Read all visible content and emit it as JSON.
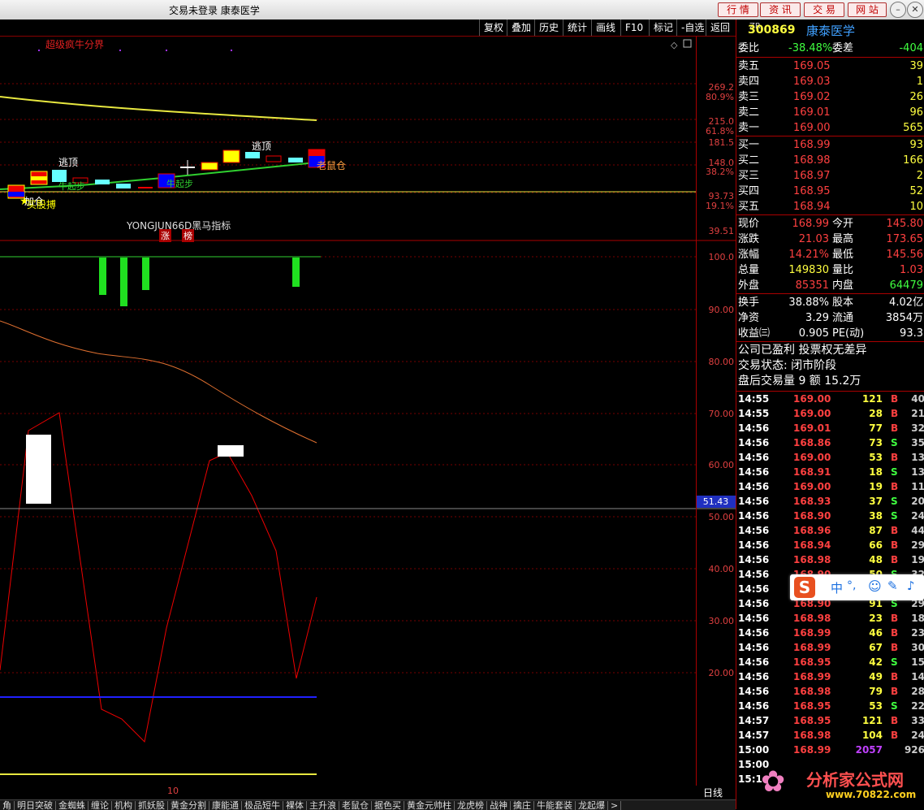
{
  "titlebar": {
    "title": "交易未登录  康泰医学",
    "buttons": [
      "行 情",
      "资 讯",
      "交 易",
      "网 站"
    ]
  },
  "menubar": {
    "items": [
      "复权",
      "叠加",
      "历史",
      "统计",
      "画线",
      "F10",
      "标记",
      "-自选",
      "返回"
    ]
  },
  "main_chart": {
    "indicator_name": "超级疯牛分界",
    "axis_labels": [
      "269.2",
      "80.9%",
      "215.0",
      "61.8%",
      "181.5",
      "148.0",
      "38.2%",
      "93.73",
      "19.1%",
      "39.51"
    ],
    "annotations": [
      "逃顶",
      "逃顶",
      "老鼠仓",
      "牛起步",
      "牛起步",
      "加仓",
      "买股搏"
    ],
    "sub_indicator": "YONGJUN66D黑马指标",
    "tags": [
      "涨",
      "榜"
    ]
  },
  "osc_chart": {
    "axis_labels": [
      "100.0",
      "90.00",
      "80.00",
      "70.00",
      "60.00",
      "50.00",
      "40.00",
      "30.00",
      "20.00"
    ],
    "current_value": "51.43"
  },
  "date_label": "10",
  "period_label": "日线",
  "bottom_tabs": [
    "角",
    "明日突破",
    "金蜘蛛",
    "缠论",
    "机构",
    "抓妖股",
    "黄金分割",
    "康能通",
    "极品短牛",
    "裸体",
    "主升浪",
    "老鼠仓",
    "据色买",
    "黄金元帅柱",
    "龙虎榜",
    "战神",
    "擒庄",
    "牛能套装",
    "龙起爆",
    ">"
  ],
  "quote": {
    "code": "300869",
    "name": "康泰医学",
    "prefix": "ZR",
    "weibi_label": "委比",
    "weibi": "-38.48%",
    "weicha_label": "委差",
    "weicha": "-404",
    "sells": [
      {
        "label": "卖五",
        "price": "169.05",
        "vol": "39"
      },
      {
        "label": "卖四",
        "price": "169.03",
        "vol": "1"
      },
      {
        "label": "卖三",
        "price": "169.02",
        "vol": "26"
      },
      {
        "label": "卖二",
        "price": "169.01",
        "vol": "96"
      },
      {
        "label": "卖一",
        "price": "169.00",
        "vol": "565"
      }
    ],
    "buys": [
      {
        "label": "买一",
        "price": "168.99",
        "vol": "93"
      },
      {
        "label": "买二",
        "price": "168.98",
        "vol": "166"
      },
      {
        "label": "买三",
        "price": "168.97",
        "vol": "2"
      },
      {
        "label": "买四",
        "price": "168.95",
        "vol": "52"
      },
      {
        "label": "买五",
        "price": "168.94",
        "vol": "10"
      }
    ],
    "stats": [
      {
        "l1": "现价",
        "v1": "168.99",
        "l2": "今开",
        "v2": "145.80",
        "c1": "#ff4040",
        "c2": "#ff4040"
      },
      {
        "l1": "涨跌",
        "v1": "21.03",
        "l2": "最高",
        "v2": "173.65",
        "c1": "#ff4040",
        "c2": "#ff4040"
      },
      {
        "l1": "涨幅",
        "v1": "14.21%",
        "l2": "最低",
        "v2": "145.56",
        "c1": "#ff4040",
        "c2": "#ff4040"
      },
      {
        "l1": "总量",
        "v1": "149830",
        "l2": "量比",
        "v2": "1.03",
        "c1": "#ffff40",
        "c2": "#ff4040"
      },
      {
        "l1": "外盘",
        "v1": "85351",
        "l2": "内盘",
        "v2": "64479",
        "c1": "#ff4040",
        "c2": "#40ff40"
      }
    ],
    "stats2": [
      {
        "l1": "换手",
        "v1": "38.88%",
        "l2": "股本",
        "v2": "4.02亿"
      },
      {
        "l1": "净资",
        "v1": "3.29",
        "l2": "流通",
        "v2": "3854万"
      },
      {
        "l1": "收益㈢",
        "v1": "0.905",
        "l2": "PE(动)",
        "v2": "93.3"
      }
    ],
    "notes": [
      "公司已盈利 投票权无差异",
      "交易状态: 闭市阶段",
      "盘后交易量 9 额 15.2万"
    ],
    "ticks": [
      {
        "t": "14:55",
        "p": "169.00",
        "v": "121",
        "d": "B",
        "n": "40"
      },
      {
        "t": "14:55",
        "p": "169.00",
        "v": "28",
        "d": "B",
        "n": "21"
      },
      {
        "t": "14:56",
        "p": "169.01",
        "v": "77",
        "d": "B",
        "n": "32"
      },
      {
        "t": "14:56",
        "p": "168.86",
        "v": "73",
        "d": "S",
        "n": "35"
      },
      {
        "t": "14:56",
        "p": "169.00",
        "v": "53",
        "d": "B",
        "n": "13"
      },
      {
        "t": "14:56",
        "p": "168.91",
        "v": "18",
        "d": "S",
        "n": "13"
      },
      {
        "t": "14:56",
        "p": "169.00",
        "v": "19",
        "d": "B",
        "n": "11"
      },
      {
        "t": "14:56",
        "p": "168.93",
        "v": "37",
        "d": "S",
        "n": "20"
      },
      {
        "t": "14:56",
        "p": "168.90",
        "v": "38",
        "d": "S",
        "n": "24"
      },
      {
        "t": "14:56",
        "p": "168.96",
        "v": "87",
        "d": "B",
        "n": "44"
      },
      {
        "t": "14:56",
        "p": "168.94",
        "v": "66",
        "d": "B",
        "n": "29"
      },
      {
        "t": "14:56",
        "p": "168.98",
        "v": "48",
        "d": "B",
        "n": "19"
      },
      {
        "t": "14:56",
        "p": "168.90",
        "v": "50",
        "d": "S",
        "n": "32"
      },
      {
        "t": "14:56",
        "p": "",
        "v": "",
        "d": "",
        "n": ""
      },
      {
        "t": "14:56",
        "p": "168.90",
        "v": "91",
        "d": "S",
        "n": "29"
      },
      {
        "t": "14:56",
        "p": "168.98",
        "v": "23",
        "d": "B",
        "n": "18"
      },
      {
        "t": "14:56",
        "p": "168.99",
        "v": "46",
        "d": "B",
        "n": "23"
      },
      {
        "t": "14:56",
        "p": "168.99",
        "v": "67",
        "d": "B",
        "n": "30"
      },
      {
        "t": "14:56",
        "p": "168.95",
        "v": "42",
        "d": "S",
        "n": "15"
      },
      {
        "t": "14:56",
        "p": "168.99",
        "v": "49",
        "d": "B",
        "n": "14"
      },
      {
        "t": "14:56",
        "p": "168.98",
        "v": "79",
        "d": "B",
        "n": "28"
      },
      {
        "t": "14:56",
        "p": "168.95",
        "v": "53",
        "d": "S",
        "n": "22"
      },
      {
        "t": "14:57",
        "p": "168.95",
        "v": "121",
        "d": "B",
        "n": "33"
      },
      {
        "t": "14:57",
        "p": "168.98",
        "v": "104",
        "d": "B",
        "n": "24"
      },
      {
        "t": "15:00",
        "p": "168.99",
        "v": "2057",
        "d": "",
        "n": "926"
      },
      {
        "t": "15:00",
        "p": "",
        "v": "",
        "d": "",
        "n": ""
      },
      {
        "t": "15:1",
        "p": "",
        "v": "",
        "d": "",
        "n": ""
      }
    ]
  },
  "ime": {
    "logo": "S",
    "lang": "中"
  },
  "watermark": {
    "text": "分析家公式网",
    "url": "www.70822.com"
  },
  "colors": {
    "up": "#ff4040",
    "down": "#40ff40",
    "label": "#ffffff",
    "yellow": "#ffff40"
  }
}
